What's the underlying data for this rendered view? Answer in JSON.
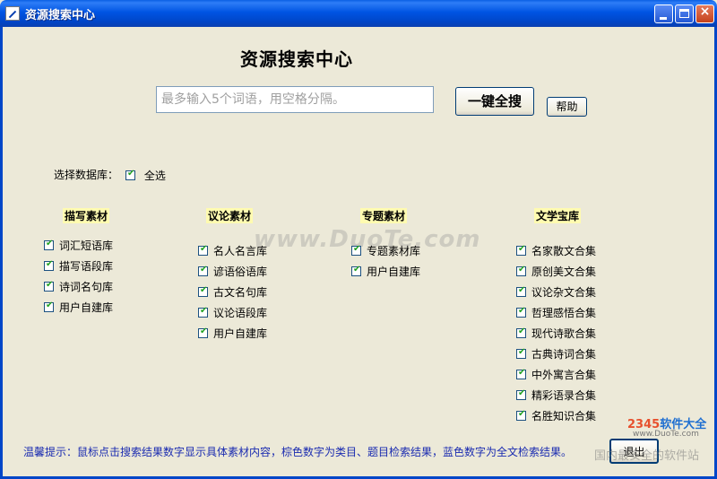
{
  "window": {
    "title": "资源搜索中心",
    "buttons": [
      "minimize",
      "maximize",
      "close"
    ],
    "close_glyph": "×"
  },
  "heading": "资源搜索中心",
  "search": {
    "placeholder": "最多输入5个词语，用空格分隔。",
    "value": "",
    "button_label": "一键全搜",
    "help_label": "帮助"
  },
  "database": {
    "label": "选择数据库：",
    "select_all_label": "全选",
    "select_all_checked": true
  },
  "categories": [
    {
      "title": "描写素材",
      "items": [
        {
          "label": "词汇短语库",
          "checked": true
        },
        {
          "label": "描写语段库",
          "checked": true
        },
        {
          "label": "诗词名句库",
          "checked": true
        },
        {
          "label": "用户自建库",
          "checked": true
        }
      ]
    },
    {
      "title": "议论素材",
      "items": [
        {
          "label": "名人名言库",
          "checked": true
        },
        {
          "label": "谚语俗语库",
          "checked": true
        },
        {
          "label": "古文名句库",
          "checked": true
        },
        {
          "label": "议论语段库",
          "checked": true
        },
        {
          "label": "用户自建库",
          "checked": true
        }
      ]
    },
    {
      "title": "专题素材",
      "items": [
        {
          "label": "专题素材库",
          "checked": true
        },
        {
          "label": "用户自建库",
          "checked": true
        }
      ]
    },
    {
      "title": "文学宝库",
      "items": [
        {
          "label": "名家散文合集",
          "checked": true
        },
        {
          "label": "原创美文合集",
          "checked": true
        },
        {
          "label": "议论杂文合集",
          "checked": true
        },
        {
          "label": "哲理感悟合集",
          "checked": true
        },
        {
          "label": "现代诗歌合集",
          "checked": true
        },
        {
          "label": "古典诗词合集",
          "checked": true
        },
        {
          "label": "中外寓言合集",
          "checked": true
        },
        {
          "label": "精彩语录合集",
          "checked": true
        },
        {
          "label": "名胜知识合集",
          "checked": true
        }
      ]
    }
  ],
  "check_glyph": "✔",
  "tip": "温馨提示：鼠标点击搜索结果数字显示具体素材内容，棕色数字为类目、题目检索结果，蓝色数字为全文检索结果。",
  "exit_label": "退出",
  "watermarks": {
    "center": "www.DuoTe.com",
    "logo_num": "2345",
    "logo_text": "软件大全",
    "logo_url": "www.DuoTe.com",
    "bottom": "国内最安全的软件站"
  },
  "colors": {
    "titlebar": "#0054e3",
    "background": "#ece9d8",
    "tip_text": "#1a2bb0",
    "category_highlight": "#fffbb0",
    "check": "#21a121"
  }
}
